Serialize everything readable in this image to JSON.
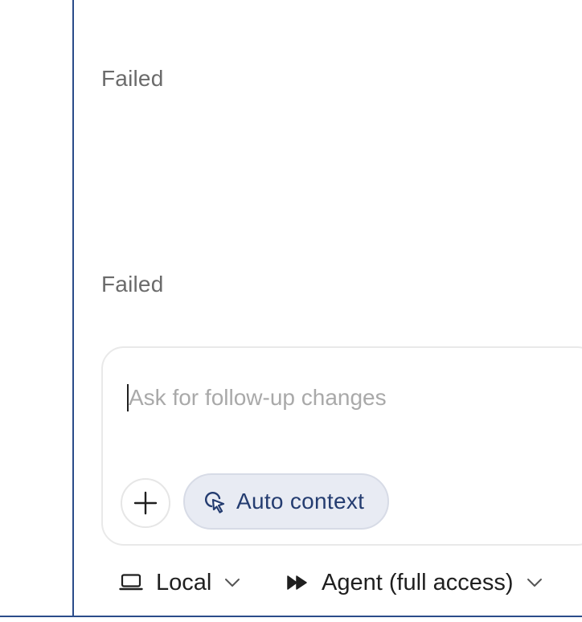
{
  "messages": [
    {
      "status": "Failed"
    },
    {
      "status": "Failed"
    }
  ],
  "composer": {
    "placeholder": "Ask for follow-up changes",
    "value": "",
    "add_button_icon": "plus-icon",
    "context_chip": {
      "label": "Auto context",
      "icon": "cursor-click-icon"
    }
  },
  "footer": {
    "environment": {
      "label": "Local",
      "icon": "laptop-icon"
    },
    "mode": {
      "label": "Agent (full access)",
      "icon": "fast-forward-icon"
    }
  },
  "colors": {
    "accent": "#2b4c8a",
    "chip_bg": "#e8ebf3",
    "chip_text": "#243c70",
    "muted_text": "#6b6b6b",
    "placeholder": "#a9a9a9"
  }
}
